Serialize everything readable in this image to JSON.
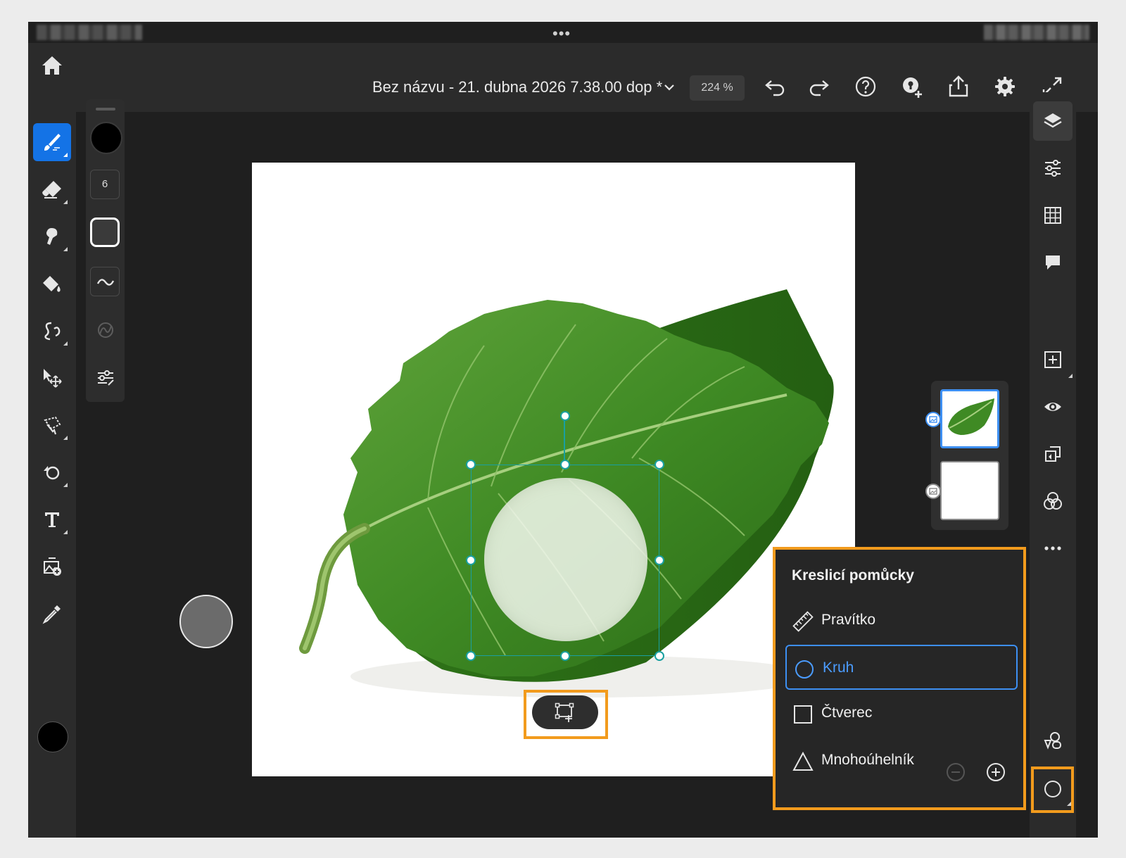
{
  "app": {
    "document_title": "Bez názvu - 21. dubna 2026 7.38.00 dop *",
    "zoom": "224 %",
    "accent_color": "#1473e6",
    "highlight_color": "#f29b1d"
  },
  "toolbar_top": {
    "icons": [
      "home-icon",
      "chevron-down-icon",
      "undo-icon",
      "redo-icon",
      "help-icon",
      "learn-icon",
      "share-icon",
      "settings-icon",
      "fullscreen-icon"
    ]
  },
  "left_tools": [
    "brush-tool",
    "eraser-tool",
    "smudge-tool",
    "fill-tool",
    "liquify-tool",
    "move-tool",
    "lasso-tool",
    "clone-tool",
    "type-tool",
    "image-tool",
    "eyedropper-tool"
  ],
  "tool_properties": {
    "brush_size": "6"
  },
  "drawing_aids": {
    "title": "Kreslicí pomůcky",
    "options": [
      {
        "label": "Pravítko",
        "icon": "ruler-icon",
        "selected": false
      },
      {
        "label": "Kruh",
        "icon": "circle-icon",
        "selected": true
      },
      {
        "label": "Čtverec",
        "icon": "square-icon",
        "selected": false
      },
      {
        "label": "Mnohoúhelník",
        "icon": "triangle-icon",
        "selected": false
      }
    ]
  },
  "layers": {
    "count": 2,
    "selected_index": 0
  }
}
